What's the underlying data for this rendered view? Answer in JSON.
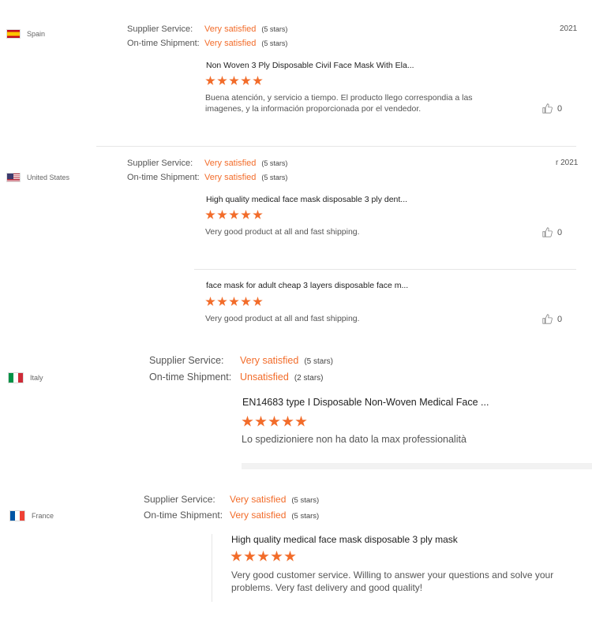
{
  "reviews": [
    {
      "country": "Spain",
      "date": "2021",
      "supplier_label": "Supplier Service:",
      "supplier_value": "Very satisfied",
      "supplier_stars": "(5 stars)",
      "shipment_label": "On-time Shipment:",
      "shipment_value": "Very satisfied",
      "shipment_stars": "(5 stars)",
      "items": [
        {
          "product": "Non Woven 3 Ply Disposable Civil Face Mask With Ela...",
          "rating": 5,
          "comment": "Buena atención, y servicio a tiempo. El producto llego correspondia a las imagenes, y la información proporcionada por el vendedor.",
          "likes": "0"
        }
      ]
    },
    {
      "country": "United States",
      "date": "r 2021",
      "supplier_label": "Supplier Service:",
      "supplier_value": "Very satisfied",
      "supplier_stars": "(5 stars)",
      "shipment_label": "On-time Shipment:",
      "shipment_value": "Very satisfied",
      "shipment_stars": "(5 stars)",
      "items": [
        {
          "product": "High quality medical face mask disposable 3 ply dent...",
          "rating": 5,
          "comment": "Very good product at all and fast shipping.",
          "likes": "0"
        },
        {
          "product": "face mask for adult cheap 3 layers disposable face m...",
          "rating": 5,
          "comment": "Very good product at all and fast shipping.",
          "likes": "0"
        }
      ]
    },
    {
      "country": "Italy",
      "supplier_label": "Supplier Service:",
      "supplier_value": "Very satisfied",
      "supplier_stars": "(5 stars)",
      "shipment_label": "On-time Shipment:",
      "shipment_value": "Unsatisfied",
      "shipment_stars": "(2 stars)",
      "items": [
        {
          "product": "EN14683 type I Disposable Non-Woven Medical Face ...",
          "rating": 5,
          "comment": "Lo spedizioniere non ha dato la max professionalità"
        }
      ]
    },
    {
      "country": "France",
      "supplier_label": "Supplier Service:",
      "supplier_value": "Very satisfied",
      "supplier_stars": "(5 stars)",
      "shipment_label": "On-time Shipment:",
      "shipment_value": "Very satisfied",
      "shipment_stars": "(5 stars)",
      "items": [
        {
          "product": "High quality medical face mask disposable 3 ply mask",
          "rating": 5,
          "comment": "Very good customer service. Willing to answer your questions and solve your problems. Very fast delivery and good quality!"
        }
      ]
    }
  ],
  "colors": {
    "accent": "#f26c2a",
    "text": "#333333",
    "muted": "#555555",
    "divider": "#e6e6e6"
  },
  "icons": {
    "like": "thumbs-up-icon",
    "star": "star-icon"
  }
}
